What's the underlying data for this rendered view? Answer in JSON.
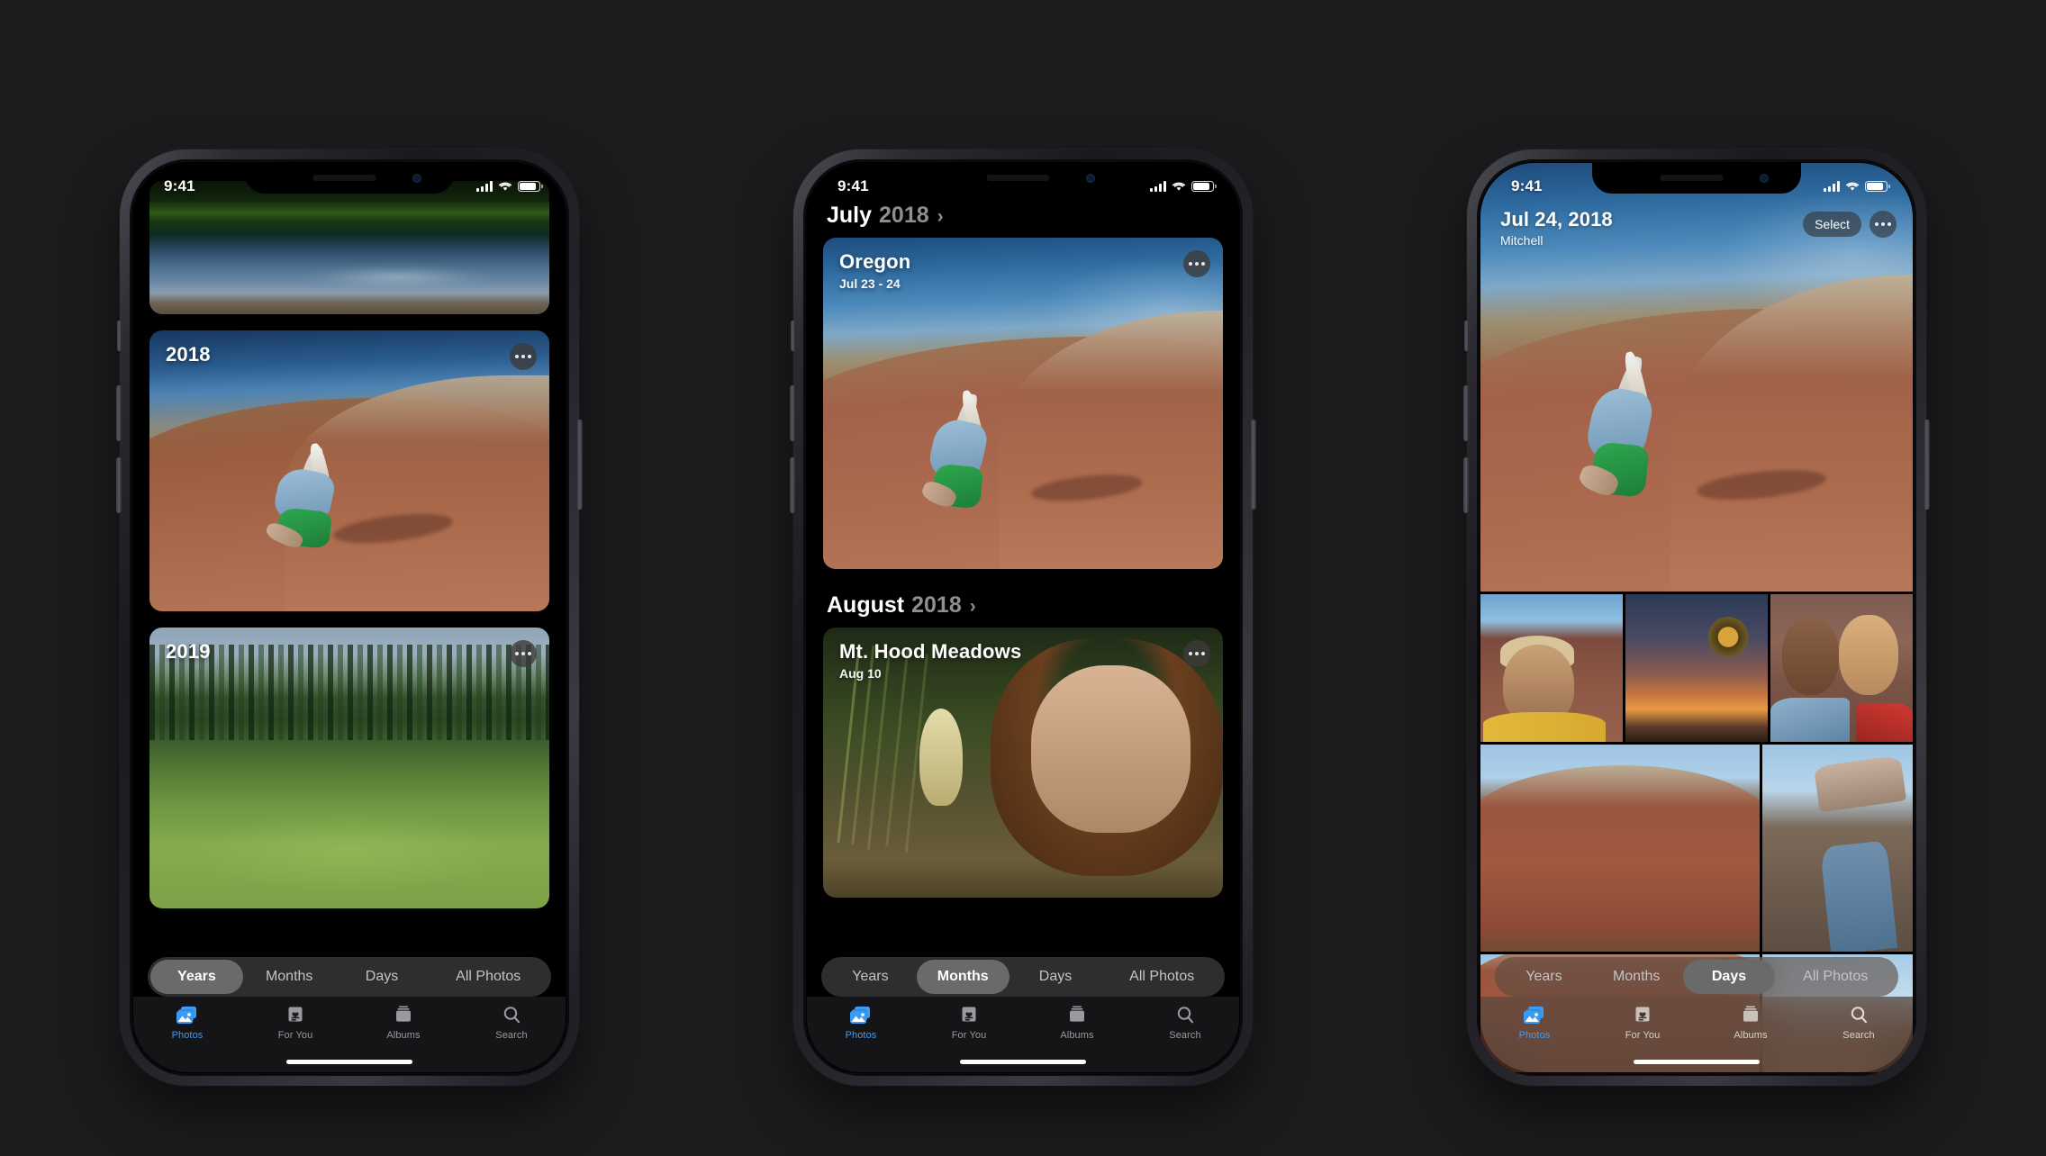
{
  "background_color": "#1c1c1e",
  "accent_color": "#3b9cf5",
  "status_bar": {
    "time": "9:41",
    "signal_icon": "cellular-signal-icon",
    "wifi_icon": "wifi-icon",
    "battery_icon": "battery-icon"
  },
  "segmented_control": {
    "options": [
      "Years",
      "Months",
      "Days",
      "All Photos"
    ]
  },
  "tab_bar": {
    "tabs": [
      {
        "label": "Photos",
        "icon": "photos-icon"
      },
      {
        "label": "For You",
        "icon": "for-you-icon"
      },
      {
        "label": "Albums",
        "icon": "albums-icon"
      },
      {
        "label": "Search",
        "icon": "search-icon"
      }
    ]
  },
  "phones": [
    {
      "id": "phone-years",
      "view": "Years",
      "active_segment": "Years",
      "active_tab": "Photos",
      "cards": [
        {
          "title": "",
          "photo": "lake-reflection-photo",
          "has_more": false
        },
        {
          "title": "2018",
          "photo": "painted-hills-cartwheel-photo",
          "has_more": true
        },
        {
          "title": "2019",
          "photo": "mountain-meadow-photo",
          "has_more": true
        }
      ],
      "more_icon": "ellipsis-icon"
    },
    {
      "id": "phone-months",
      "view": "Months",
      "active_segment": "Months",
      "active_tab": "Photos",
      "sections": [
        {
          "month": "July",
          "year": "2018",
          "chevron": "chevron-right-icon",
          "card": {
            "title": "Oregon",
            "subtitle": "Jul 23 - 24",
            "photo": "painted-hills-cartwheel-photo",
            "more_icon": "ellipsis-icon"
          }
        },
        {
          "month": "August",
          "year": "2018",
          "chevron": "chevron-right-icon",
          "card": {
            "title": "Mt. Hood Meadows",
            "subtitle": "Aug 10",
            "photo": "bear-grass-portrait-photo",
            "more_icon": "ellipsis-icon"
          }
        }
      ]
    },
    {
      "id": "phone-days",
      "view": "Days",
      "active_segment": "Days",
      "active_tab": "Photos",
      "header": {
        "title": "Jul 24, 2018",
        "subtitle": "Mitchell",
        "select_label": "Select",
        "more_icon": "ellipsis-icon"
      },
      "grid": {
        "hero": "painted-hills-cartwheel-photo",
        "rows": [
          [
            "boy-in-hills-photo",
            "sunflower-sunset-photo",
            "couple-selfie-photo"
          ],
          [
            "red-mountain-photo",
            "boot-closeup-photo"
          ],
          [
            "red-mountain-photo",
            "dune-sky-photo"
          ]
        ]
      }
    }
  ]
}
